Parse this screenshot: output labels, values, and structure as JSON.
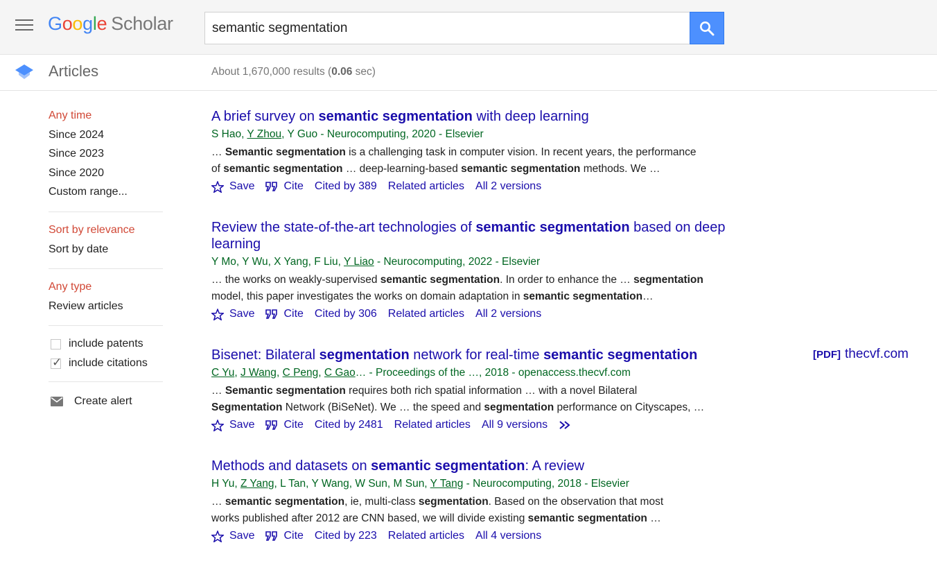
{
  "header": {
    "logo": {
      "g1": "G",
      "o1": "o",
      "o2": "o",
      "g2": "g",
      "l": "l",
      "e": "e",
      "product": "Scholar"
    },
    "search_value": "semantic segmentation"
  },
  "subbar": {
    "section_label": "Articles",
    "stats_prefix": "About 1,670,000 results (",
    "stats_time": "0.06",
    "stats_suffix": " sec)"
  },
  "sidebar": {
    "time_filters": [
      "Any time",
      "Since 2024",
      "Since 2023",
      "Since 2020",
      "Custom range..."
    ],
    "sort_options": [
      "Sort by relevance",
      "Sort by date"
    ],
    "type_filters": [
      "Any type",
      "Review articles"
    ],
    "include_patents": "include patents",
    "include_citations": "include citations",
    "create_alert": "Create alert"
  },
  "results": [
    {
      "title_parts": [
        "A brief survey on ",
        "semantic segmentation",
        " with deep learning"
      ],
      "meta_parts": [
        "S Hao, ",
        "Y Zhou",
        ", Y Guo - Neurocomputing, 2020 - Elsevier"
      ],
      "snippet_line1": [
        "… ",
        "Semantic segmentation",
        " is a challenging task in computer vision. In recent years, the performance"
      ],
      "snippet_line2": [
        "of ",
        "semantic segmentation",
        " … deep-learning-based ",
        "semantic segmentation",
        " methods. We …"
      ],
      "save": "Save",
      "cite": "Cite",
      "cited_by": "Cited by 389",
      "related": "Related articles",
      "versions": "All 2 versions"
    },
    {
      "title_parts": [
        "Review the state-of-the-art technologies of ",
        "semantic segmentation",
        " based on deep learning"
      ],
      "meta_parts": [
        "Y Mo, Y Wu, X Yang, F Liu, ",
        "Y Liao",
        " - Neurocomputing, 2022 - Elsevier"
      ],
      "snippet_line1": [
        "… the works on weakly-supervised ",
        "semantic segmentation",
        ". In order to enhance the … ",
        "segmentation"
      ],
      "snippet_line2": [
        "model, this paper investigates the works on domain adaptation in ",
        "semantic segmentation",
        "…"
      ],
      "save": "Save",
      "cite": "Cite",
      "cited_by": "Cited by 306",
      "related": "Related articles",
      "versions": "All 2 versions"
    },
    {
      "title_parts": [
        "Bisenet: Bilateral ",
        "segmentation",
        " network for real-time ",
        "semantic segmentation"
      ],
      "meta_authors": [
        "C Yu",
        "J Wang",
        "C Peng",
        "C Gao"
      ],
      "meta_suffix": "… - Proceedings of the …, 2018 - openaccess.thecvf.com",
      "snippet_line1": [
        "… ",
        "Semantic segmentation",
        " requires both rich spatial information … with a novel Bilateral"
      ],
      "snippet_line2": [
        "Segmentation",
        " Network (BiSeNet). We … the speed and ",
        "segmentation",
        " performance on Cityscapes, …"
      ],
      "save": "Save",
      "cite": "Cite",
      "cited_by": "Cited by 2481",
      "related": "Related articles",
      "versions": "All 9 versions",
      "pdf_tag": "[PDF]",
      "pdf_source": "thecvf.com"
    },
    {
      "title_parts": [
        "Methods and datasets on ",
        "semantic segmentation",
        ": A review"
      ],
      "meta_parts": [
        "H Yu, ",
        "Z Yang",
        ", L Tan, Y Wang, W Sun, M Sun, ",
        "Y Tang",
        " - Neurocomputing, 2018 - Elsevier"
      ],
      "snippet_line1": [
        "… ",
        "semantic segmentation",
        ", ie, multi-class ",
        "segmentation",
        ". Based on the observation that most"
      ],
      "snippet_line2": [
        "works published after 2012 are CNN based, we will divide existing ",
        "semantic segmentation",
        " …"
      ],
      "save": "Save",
      "cite": "Cite",
      "cited_by": "Cited by 223",
      "related": "Related articles",
      "versions": "All 4 versions"
    }
  ],
  "colors": {
    "link": "#1a0dab",
    "meta": "#006621",
    "active_filter": "#d14836",
    "search_button": "#4d90fe"
  }
}
